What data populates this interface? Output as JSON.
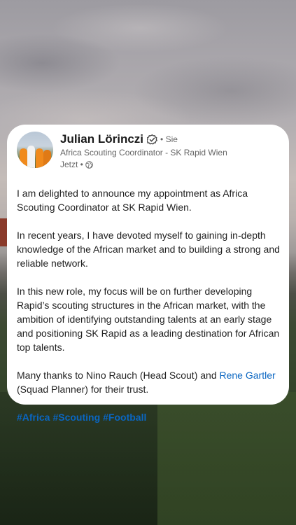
{
  "post": {
    "author": "Julian Lörinczi",
    "follow_text": "Sie",
    "headline": "Africa Scouting Coordinator - SK Rapid Wien",
    "time": "Jetzt",
    "paragraphs": [
      "I am delighted to announce my appointment as Africa Scouting Coordinator at SK Rapid Wien.",
      "In recent years, I have devoted myself to gaining in-depth knowledge of the African market and to building a strong and reliable network.",
      "In this new role, my focus will be on further developing Rapid’s scouting structures in the African market, with the ambition of identifying outstanding talents at an early stage and positioning SK Rapid as a leading destination for African top talents."
    ],
    "thanks_before": "Many thanks to Nino Rauch (Head Scout) and ",
    "thanks_mention": "Rene Gartler",
    "thanks_after": " (Squad Planner) for their trust.",
    "hashtags": [
      "#Africa",
      "#Scouting",
      "#Football"
    ]
  },
  "colors": {
    "link": "#0a66c2",
    "card": "#ffffff"
  },
  "icons": [
    "verified-icon",
    "globe-icon"
  ]
}
